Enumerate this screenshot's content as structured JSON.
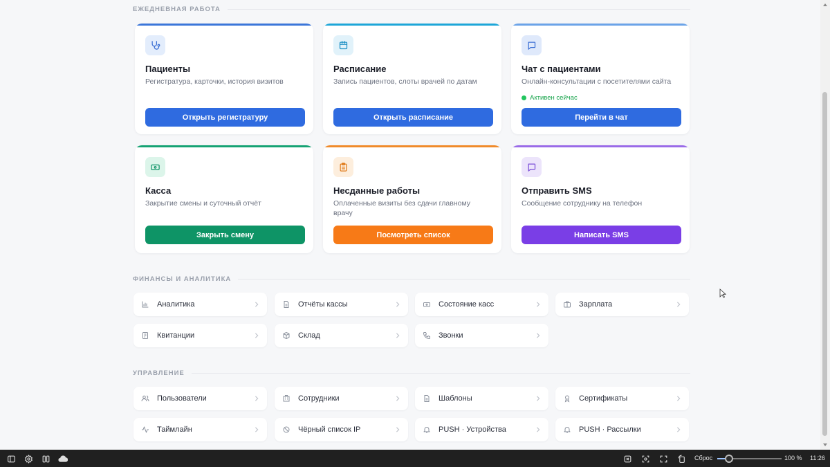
{
  "sections": {
    "daily": "ЕЖЕДНЕВНАЯ РАБОТА",
    "finance": "ФИНАНСЫ И АНАЛИТИКА",
    "management": "УПРАВЛЕНИЕ"
  },
  "cards": [
    {
      "title": "Пациенты",
      "desc": "Регистратура, карточки, история визитов",
      "button": "Открыть регистратуру",
      "accent": "#3b76d9",
      "icon": "stethoscope-icon",
      "icon_bg": "#e3edfc",
      "icon_color": "#3b6fd4",
      "btn_color": "#2f6be0"
    },
    {
      "title": "Расписание",
      "desc": "Запись пациентов, слоты врачей по датам",
      "button": "Открыть расписание",
      "accent": "#1da6d8",
      "icon": "calendar-icon",
      "icon_bg": "#e1f2fa",
      "icon_color": "#1b8fc4",
      "btn_color": "#2f6be0"
    },
    {
      "title": "Чат с пациентами",
      "desc": "Онлайн-консультации с посетителями сайта",
      "button": "Перейти в чат",
      "status": "Активен сейчас",
      "accent": "#6ba3e8",
      "icon": "chat-icon",
      "icon_bg": "#dfe9fb",
      "icon_color": "#3b6fd4",
      "btn_color": "#2f6be0"
    },
    {
      "title": "Касса",
      "desc": "Закрытие смены и суточный отчёт",
      "button": "Закрыть смену",
      "accent": "#15a273",
      "icon": "cash-icon",
      "icon_bg": "#dcf5ea",
      "icon_color": "#129568",
      "btn_color": "#0e9466"
    },
    {
      "title": "Несданные работы",
      "desc": "Оплаченные визиты без сдачи главному врачу",
      "button": "Посмотреть список",
      "accent": "#f08a2a",
      "icon": "clipboard-icon",
      "icon_bg": "#fdeedd",
      "icon_color": "#e07b1a",
      "btn_color": "#f77a17"
    },
    {
      "title": "Отправить SMS",
      "desc": "Сообщение сотруднику на телефон",
      "button": "Написать SMS",
      "accent": "#9a6be8",
      "icon": "message-icon",
      "icon_bg": "#ece4fb",
      "icon_color": "#7b4fd8",
      "btn_color": "#7a3ee6"
    }
  ],
  "finance": [
    {
      "label": "Аналитика",
      "icon": "bar-chart-icon"
    },
    {
      "label": "Отчёты кассы",
      "icon": "document-icon"
    },
    {
      "label": "Состояние касс",
      "icon": "cash-register-icon"
    },
    {
      "label": "Зарплата",
      "icon": "briefcase-icon"
    },
    {
      "label": "Квитанции",
      "icon": "receipt-icon"
    },
    {
      "label": "Склад",
      "icon": "box-icon"
    },
    {
      "label": "Звонки",
      "icon": "phone-icon"
    }
  ],
  "management": [
    {
      "label": "Пользователи",
      "icon": "users-icon"
    },
    {
      "label": "Сотрудники",
      "icon": "building-icon"
    },
    {
      "label": "Шаблоны",
      "icon": "template-icon"
    },
    {
      "label": "Сертификаты",
      "icon": "award-icon"
    },
    {
      "label": "Таймлайн",
      "icon": "activity-icon"
    },
    {
      "label": "Чёрный список IP",
      "icon": "block-icon"
    },
    {
      "label": "PUSH · Устройства",
      "icon": "bell-icon"
    },
    {
      "label": "PUSH · Рассылки",
      "icon": "bell-icon"
    }
  ],
  "taskbar": {
    "reset_label": "Сброс",
    "zoom_label": "100 %",
    "zoom_level": 0.18,
    "clock": "11:26"
  }
}
